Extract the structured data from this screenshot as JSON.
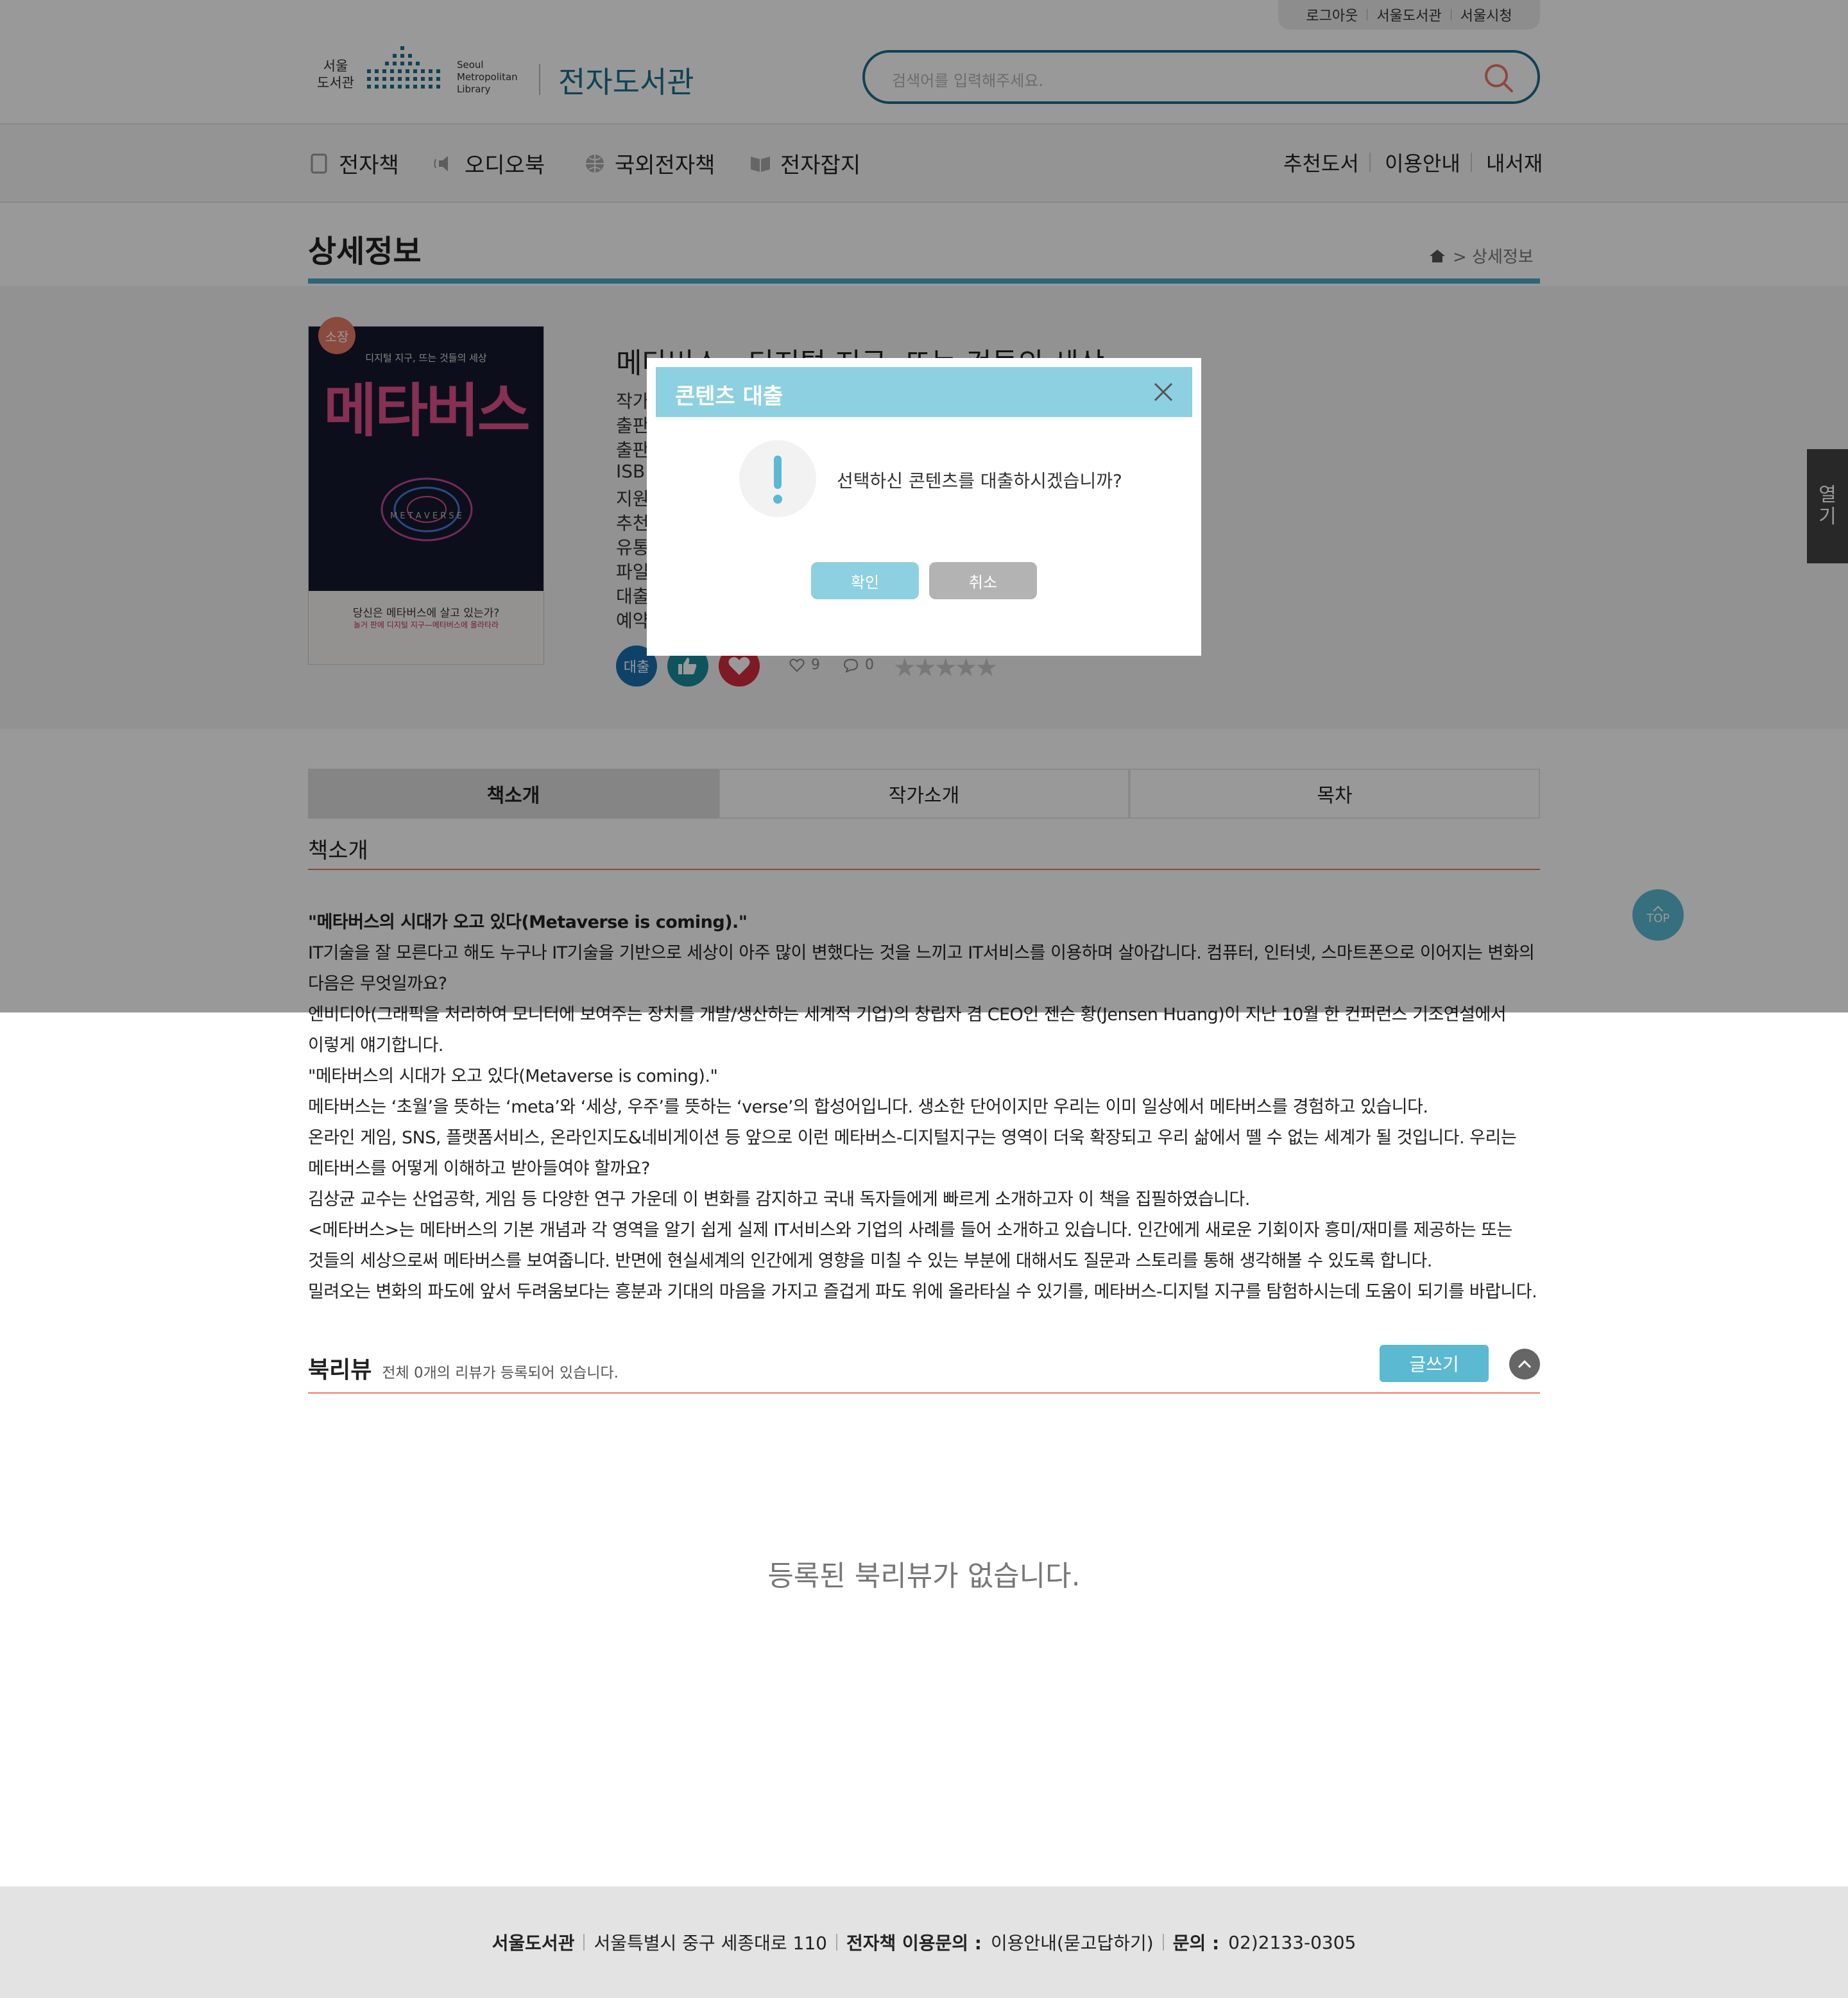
{
  "util_links": [
    "로그아웃",
    "서울도서관",
    "서울시청"
  ],
  "logo": {
    "kr": [
      "서울",
      "도서관"
    ],
    "en": [
      "Seoul",
      "Metropolitan",
      "Library"
    ],
    "site_name": "전자도서관"
  },
  "search": {
    "placeholder": "검색어를 입력해주세요."
  },
  "nav": {
    "left": [
      "전자책",
      "오디오북",
      "국외전자책",
      "전자잡지"
    ],
    "right": [
      "추천도서",
      "이용안내",
      "내서재"
    ]
  },
  "page": {
    "title": "상세정보",
    "breadcrumb": "> 상세정보"
  },
  "book": {
    "badge": "소장",
    "cover_subtitle": "디지털 지구, 뜨는 것들의 세상",
    "cover_title": "메타버스",
    "cover_mid": "M E T A V E R S E",
    "cover_tag": "당신은 메타버스에 살고 있는가?",
    "cover_tag2": "놀거 판에 디지털 지구—메타버스에 올라타라",
    "title": "메타버스 - 디지털 지구, 뜨는 것들의 세상",
    "meta_labels": [
      "작가",
      "출판",
      "출판",
      "ISBN",
      "지원",
      "추천",
      "유통",
      "파일",
      "대출",
      "예약"
    ],
    "loan_label": "대출",
    "likes": "9",
    "comments": "0"
  },
  "tabs": [
    "책소개",
    "작가소개",
    "목차"
  ],
  "intro": {
    "heading": "책소개",
    "lead": "\"메타버스의 시대가 오고 있다(Metaverse is coming).\"",
    "lines": [
      "IT기술을 잘 모른다고 해도 누구나 IT기술을 기반으로 세상이 아주 많이 변했다는 것을 느끼고 IT서비스를 이용하며 살아갑니다. 컴퓨터, 인터넷, 스마트폰으로 이어지는 변화의",
      "다음은 무엇일까요?",
      "엔비디아(그래픽을 처리하여 모니터에 보여주는 장치를 개발/생산하는 세계적 기업)의 창립자 겸 CEO인 젠슨 황(Jensen Huang)이 지난 10월 한 컨퍼런스 기조연설에서",
      "이렇게 얘기합니다.",
      "\"메타버스의 시대가 오고 있다(Metaverse is coming).\"",
      "메타버스는 ‘초월’을 뜻하는 ‘meta’와 ‘세상, 우주’를 뜻하는 ‘verse’의 합성어입니다. 생소한 단어이지만 우리는 이미 일상에서 메타버스를 경험하고 있습니다.",
      "온라인 게임, SNS, 플랫폼서비스, 온라인지도&네비게이션 등 앞으로 이런 메타버스-디지털지구는 영역이 더욱 확장되고 우리 삶에서 뗄 수 없는 세계가 될 것입니다. 우리는",
      "메타버스를 어떻게 이해하고 받아들여야 할까요?",
      "김상균 교수는 산업공학, 게임 등 다양한 연구 가운데 이 변화를 감지하고 국내 독자들에게 빠르게 소개하고자 이 책을 집필하였습니다.",
      "<메타버스>는 메타버스의 기본 개념과 각 영역을 알기 쉽게 실제 IT서비스와 기업의 사례를 들어 소개하고 있습니다. 인간에게 새로운 기회이자 흥미/재미를 제공하는 또는",
      "것들의 세상으로써 메타버스를 보여줍니다. 반면에 현실세계의 인간에게 영향을 미칠 수 있는 부분에 대해서도 질문과 스토리를 통해 생각해볼 수 있도록 합니다.",
      "밀려오는 변화의 파도에 앞서 두려움보다는 흥분과 기대의 마음을 가지고 즐겁게 파도 위에 올라타실 수 있기를, 메타버스-디지털 지구를 탐험하시는데 도움이 되기를 바랍니다."
    ]
  },
  "review": {
    "title": "북리뷰",
    "count_text": "전체 0개의 리뷰가 등록되어 있습니다.",
    "write_label": "글쓰기",
    "empty_text": "등록된 북리뷰가 없습니다."
  },
  "footer": {
    "name": "서울도서관",
    "address": "서울특별시 중구 세종대로 110",
    "contact_label": "전자책 이용문의 :",
    "contact_value": "이용안내(묻고답하기)",
    "phone_label": "문의 :",
    "phone_value": "02)2133-0305"
  },
  "side": {
    "open_label": "열기",
    "top_label": "TOP"
  },
  "modal": {
    "title": "콘텐츠 대출",
    "message": "선택하신 콘텐츠를 대출하시겠습니까?",
    "ok_label": "확인",
    "cancel_label": "취소"
  },
  "colors": {
    "accent": "#5bb9d2",
    "modal_header": "#8dd0e1",
    "rule": "#e77c66",
    "search_border": "#1a6f8c"
  }
}
